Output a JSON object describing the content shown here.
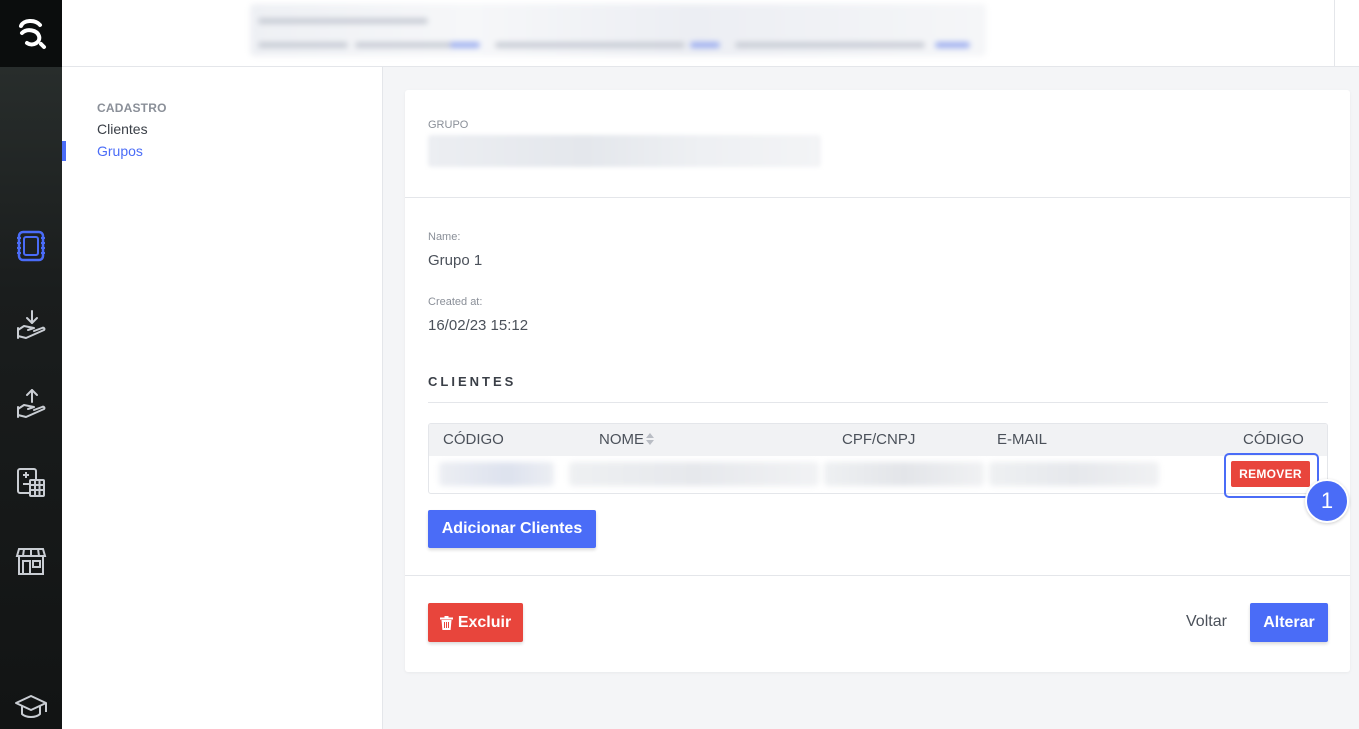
{
  "colors": {
    "accent": "#4a6cf7",
    "danger": "#e8453c",
    "rail": "#1a1d1d"
  },
  "rail": {
    "icons": [
      "app-logo",
      "notebook-icon",
      "receive-hand-icon",
      "send-hand-icon",
      "calculator-icon",
      "store-icon",
      "graduation-cap-icon"
    ]
  },
  "subnav": {
    "section": "CADASTRO",
    "items": [
      {
        "label": "Clientes",
        "active": false
      },
      {
        "label": "Grupos",
        "active": true
      }
    ]
  },
  "card": {
    "group_label": "GRUPO",
    "name_label": "Name:",
    "name_value": "Grupo 1",
    "created_label": "Created at:",
    "created_value": "16/02/23 15:12",
    "clients_title": "CLIENTES",
    "table": {
      "headers": [
        "CÓDIGO",
        "NOME",
        "CPF/CNPJ",
        "E-MAIL",
        "CÓDIGO"
      ],
      "remove_label": "REMOVER"
    },
    "annotation_number": "1",
    "add_clients_label": "Adicionar Clientes",
    "delete_label": "Excluir",
    "back_label": "Voltar",
    "update_label": "Alterar"
  }
}
